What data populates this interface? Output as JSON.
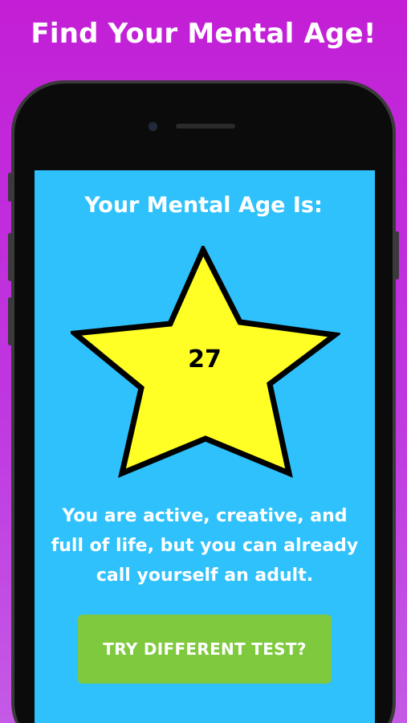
{
  "promo": {
    "headline": "Find Your Mental Age!"
  },
  "result": {
    "title": "Your Mental Age Is:",
    "age": "27",
    "description": "You are active, creative, and full of life, but you can already call yourself an adult."
  },
  "actions": {
    "retry_label": "TRY DIFFERENT TEST?"
  },
  "colors": {
    "background": "#c31fd6",
    "screen": "#2fc1fb",
    "star_fill": "#ffff26",
    "button": "#7fc93f",
    "text": "#ffffff"
  },
  "icons": {
    "star": "star-icon"
  }
}
